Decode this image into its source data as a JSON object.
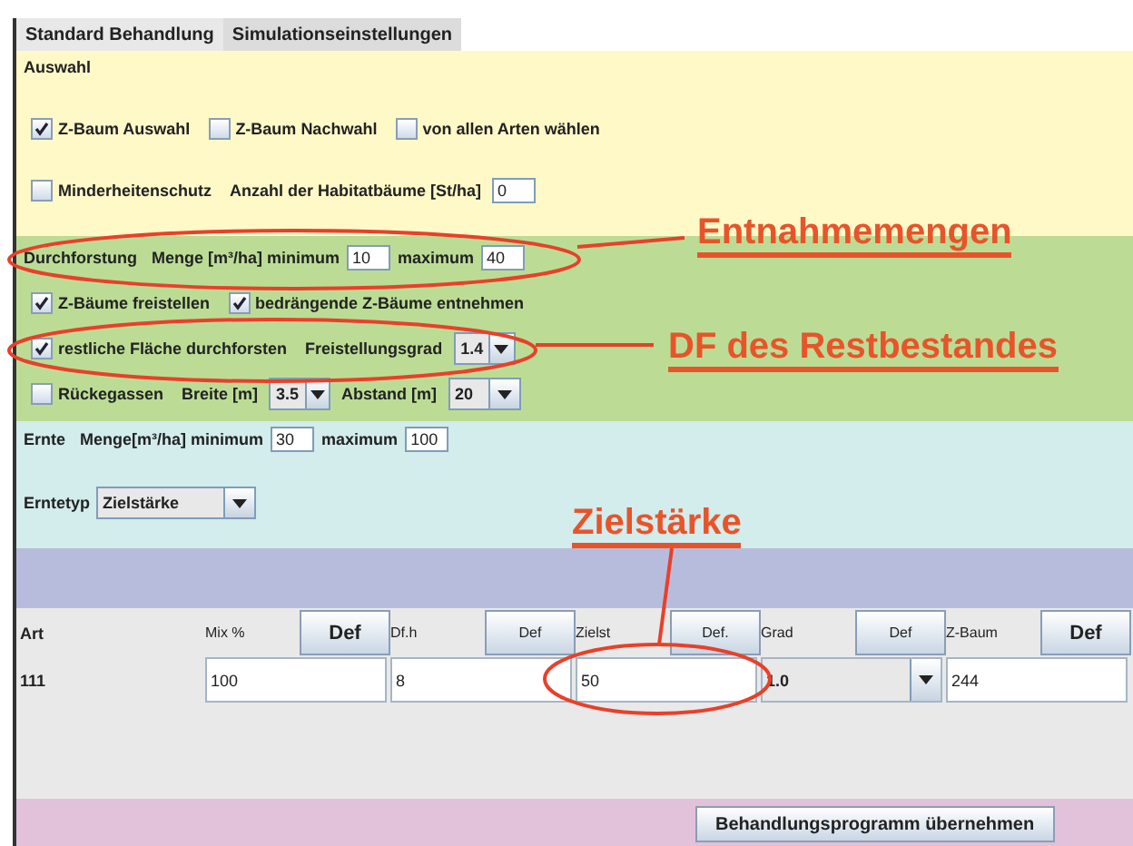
{
  "tabs": [
    {
      "label": "Standard Behandlung",
      "selected": true
    },
    {
      "label": "Simulationseinstellungen",
      "selected": false
    }
  ],
  "auswahl": {
    "title": "Auswahl",
    "checks": [
      {
        "label": "Z-Baum Auswahl",
        "checked": true
      },
      {
        "label": "Z-Baum Nachwahl",
        "checked": false
      },
      {
        "label": "von allen Arten wählen",
        "checked": false
      }
    ],
    "minderheitenschutz": {
      "label": "Minderheitenschutz",
      "checked": false
    },
    "habitat": {
      "label": "Anzahl der Habitatbäume [St/ha]",
      "value": "0"
    }
  },
  "durchforstung": {
    "title": "Durchforstung",
    "menge_label": "Menge [m³/ha] minimum",
    "min": "10",
    "max_label": "maximum",
    "max": "40",
    "checks": [
      {
        "label": "Z-Bäume freistellen",
        "checked": true
      },
      {
        "label": "bedrängende Z-Bäume entnehmen",
        "checked": true
      }
    ],
    "restliche": {
      "label": "restliche Fläche durchforsten",
      "checked": true
    },
    "grad": {
      "label": "Freistellungsgrad",
      "value": "1.4"
    },
    "rueckegassen": {
      "label": "Rückegassen",
      "checked": false
    },
    "breite": {
      "label": "Breite [m]",
      "value": "3.5"
    },
    "abstand": {
      "label": "Abstand [m]",
      "value": "20"
    }
  },
  "ernte": {
    "title": "Ernte",
    "menge_label": "Menge[m³/ha] minimum",
    "min": "30",
    "max_label": "maximum",
    "max": "100",
    "typ_label": "Erntetyp",
    "typ": "Zielstärke"
  },
  "table": {
    "first_column": "Art",
    "columns": [
      {
        "label": "Mix %",
        "button": "Def",
        "bold": true
      },
      {
        "label": "Df.h",
        "button": "Def",
        "bold": false
      },
      {
        "label": "Zielst",
        "button": "Def.",
        "bold": false
      },
      {
        "label": "Grad",
        "button": "Def",
        "bold": false
      },
      {
        "label": "Z-Baum",
        "button": "Def",
        "bold": true
      }
    ],
    "rows": [
      {
        "art": "111",
        "cells": [
          {
            "kind": "field",
            "value": "100"
          },
          {
            "kind": "field",
            "value": "8"
          },
          {
            "kind": "field",
            "value": "50"
          },
          {
            "kind": "combo",
            "value": "1.0"
          },
          {
            "kind": "field",
            "value": "244"
          }
        ]
      }
    ]
  },
  "apply_button": "Behandlungsprogramm übernehmen",
  "annotations": [
    {
      "text": "Entnahmemengen"
    },
    {
      "text": "DF des Restbestandes"
    },
    {
      "text": "Zielstärke"
    }
  ]
}
